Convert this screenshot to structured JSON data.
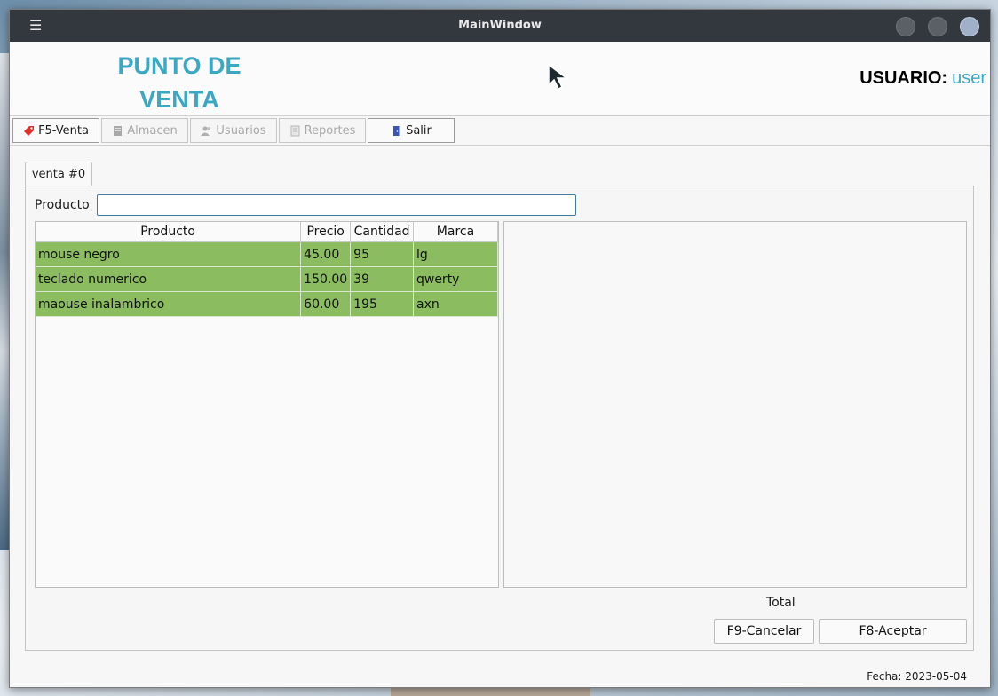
{
  "window": {
    "title": "MainWindow"
  },
  "header": {
    "brand_line1": "PUNTO DE",
    "brand_line2": "VENTA",
    "user_key": "USUARIO:",
    "user_value": "user"
  },
  "toolbar": {
    "items": [
      {
        "label": "F5-Venta",
        "icon": "tag-icon",
        "enabled": true
      },
      {
        "label": "Almacen",
        "icon": "warehouse-icon",
        "enabled": false
      },
      {
        "label": "Usuarios",
        "icon": "users-icon",
        "enabled": false
      },
      {
        "label": "Reportes",
        "icon": "report-icon",
        "enabled": false
      },
      {
        "label": "Salir",
        "icon": "exit-door-icon",
        "enabled": true
      }
    ]
  },
  "tabs": [
    {
      "label": "venta #0"
    }
  ],
  "sale": {
    "product_label": "Producto",
    "product_value": "",
    "table": {
      "headers": [
        "Producto",
        "Precio",
        "Cantidad",
        "Marca"
      ],
      "rows": [
        [
          "mouse negro",
          "45.00",
          "95",
          "lg"
        ],
        [
          "teclado numerico",
          "150.00",
          "39",
          "qwerty"
        ],
        [
          "maouse inalambrico",
          "60.00",
          "195",
          "axn"
        ]
      ]
    },
    "total_label": "Total",
    "cancel_label": "F9-Cancelar",
    "accept_label": "F8-Aceptar"
  },
  "status": {
    "fecha": "Fecha: 2023-05-04"
  },
  "colors": {
    "accent": "#3aa7c3",
    "row_green": "#8bbd60",
    "titlebar": "#33383e"
  }
}
